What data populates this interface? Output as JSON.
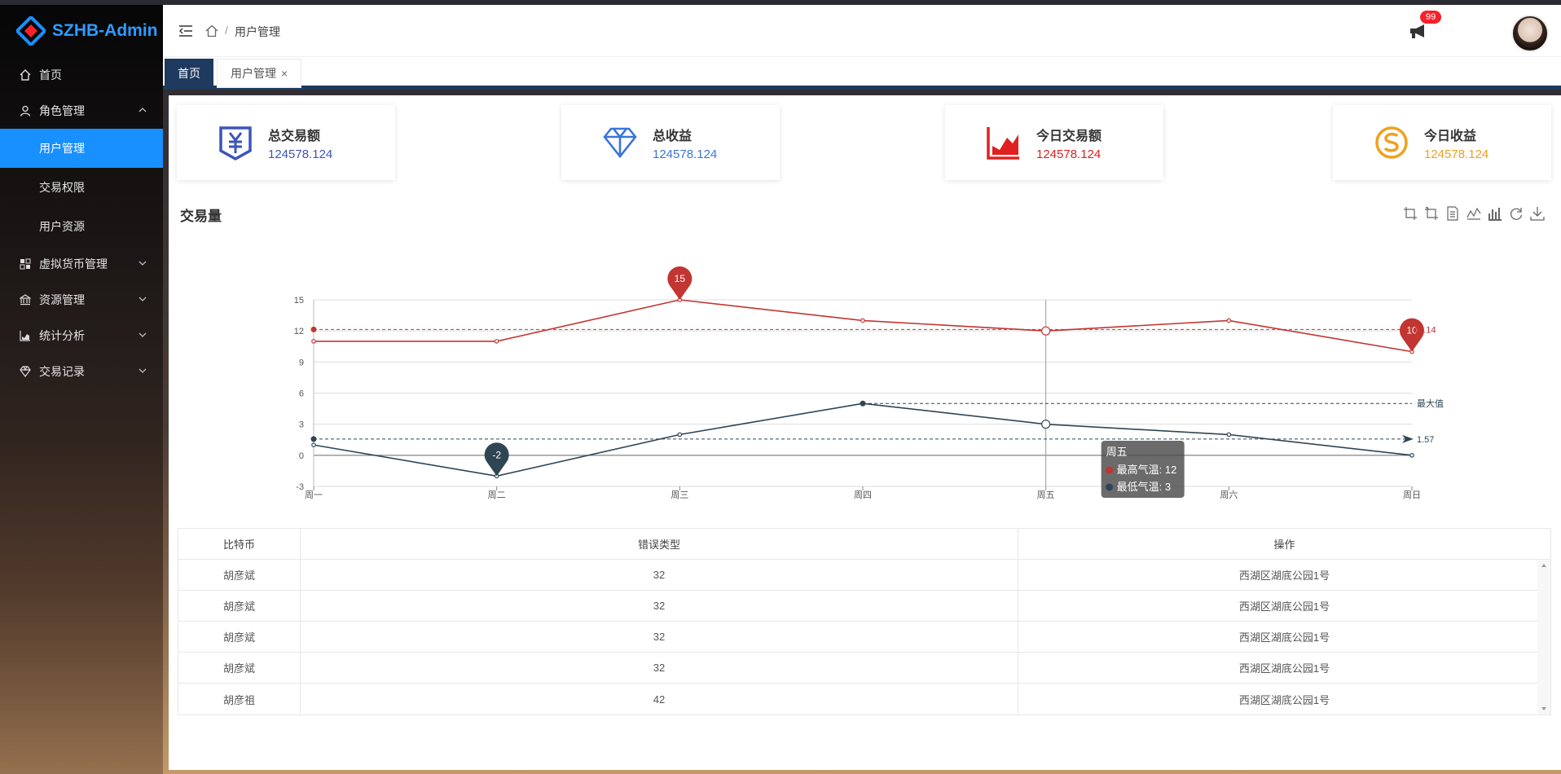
{
  "app": {
    "name": "SZHB-Admin"
  },
  "sidebar": {
    "items": [
      {
        "label": "首页"
      },
      {
        "label": "角色管理"
      },
      {
        "label": "虚拟货币管理"
      },
      {
        "label": "资源管理"
      },
      {
        "label": "统计分析"
      },
      {
        "label": "交易记录"
      }
    ],
    "sub_items": [
      {
        "label": "用户管理",
        "active": true
      },
      {
        "label": "交易权限"
      },
      {
        "label": "用户资源"
      }
    ]
  },
  "header": {
    "breadcrumb_current": "用户管理",
    "breadcrumb_sep": "/",
    "notification_count": "99"
  },
  "tabs": [
    {
      "label": "首页",
      "active": true
    },
    {
      "label": "用户管理",
      "close": "×"
    }
  ],
  "cards": [
    {
      "title": "总交易额",
      "value": "124578.124",
      "color": "#3b55b8",
      "icon": "yuan-icon"
    },
    {
      "title": "总收益",
      "value": "124578.124",
      "color": "#3b75d8",
      "icon": "diamond-icon"
    },
    {
      "title": "今日交易额",
      "value": "124578.124",
      "color": "#e02020",
      "icon": "area-chart-icon"
    },
    {
      "title": "今日收益",
      "value": "124578.124",
      "color": "#f0a020",
      "icon": "skype-icon"
    }
  ],
  "chart": {
    "title": "交易量",
    "tooltip": {
      "title": "周五",
      "line1": "最高气温: 12",
      "line2": "最低气温: 3"
    },
    "markline_labels": {
      "high_avg": "12.14",
      "low_max": "最大值",
      "low_avg": "1.57"
    }
  },
  "chart_data": {
    "type": "line",
    "categories": [
      "周一",
      "周二",
      "周三",
      "周四",
      "周五",
      "周六",
      "周日"
    ],
    "ylim": [
      -3,
      15
    ],
    "yticks": [
      -3,
      0,
      3,
      6,
      9,
      12,
      15
    ],
    "series": [
      {
        "name": "最高气温",
        "values": [
          11,
          11,
          15,
          13,
          12,
          13,
          10
        ],
        "color": "#c23531",
        "markpoints": [
          {
            "index": 2,
            "value": 15
          },
          {
            "index": 6,
            "value": 10
          }
        ],
        "avg": 12.14
      },
      {
        "name": "最低气温",
        "values": [
          1,
          -2,
          2,
          5,
          3,
          2,
          0
        ],
        "color": "#2f4554",
        "markpoints": [
          {
            "index": 1,
            "value": -2
          }
        ],
        "avg": 1.57,
        "max": 5
      }
    ]
  },
  "table": {
    "headers": [
      "比特币",
      "错误类型",
      "操作"
    ],
    "rows": [
      [
        "胡彦斌",
        "32",
        "西湖区湖底公园1号"
      ],
      [
        "胡彦斌",
        "32",
        "西湖区湖底公园1号"
      ],
      [
        "胡彦斌",
        "32",
        "西湖区湖底公园1号"
      ],
      [
        "胡彦斌",
        "32",
        "西湖区湖底公园1号"
      ],
      [
        "胡彦祖",
        "42",
        "西湖区湖底公园1号"
      ]
    ]
  }
}
